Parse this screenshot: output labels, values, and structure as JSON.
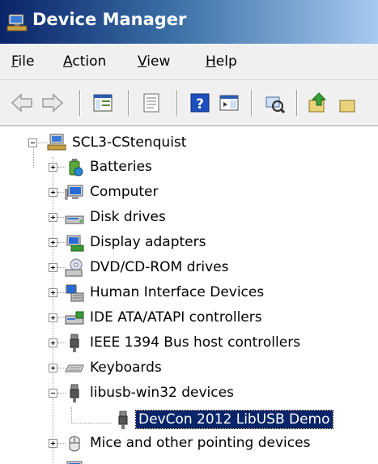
{
  "window": {
    "title": "Device Manager"
  },
  "menu": {
    "file": {
      "key": "F",
      "rest": "ile"
    },
    "action": {
      "key": "A",
      "rest": "ction"
    },
    "view": {
      "key": "V",
      "rest": "iew"
    },
    "help": {
      "key": "H",
      "rest": "elp"
    }
  },
  "tree": {
    "root": "SCL3-CStenquist",
    "items": [
      {
        "label": "Batteries",
        "icon": "battery-icon"
      },
      {
        "label": "Computer",
        "icon": "computer-icon"
      },
      {
        "label": "Disk drives",
        "icon": "disk-drive-icon"
      },
      {
        "label": "Display adapters",
        "icon": "display-adapter-icon"
      },
      {
        "label": "DVD/CD-ROM drives",
        "icon": "dvd-drive-icon"
      },
      {
        "label": "Human Interface Devices",
        "icon": "hid-icon"
      },
      {
        "label": "IDE ATA/ATAPI controllers",
        "icon": "ide-controller-icon"
      },
      {
        "label": "IEEE 1394 Bus host controllers",
        "icon": "ieee1394-icon"
      },
      {
        "label": "Keyboards",
        "icon": "keyboard-icon"
      },
      {
        "label": "libusb-win32 devices",
        "icon": "usb-icon"
      },
      {
        "label": "DevCon 2012 LibUSB Demo",
        "icon": "usb-device-icon"
      },
      {
        "label": "Mice and other pointing devices",
        "icon": "mouse-icon"
      }
    ]
  },
  "colors": {
    "selection": "#0a246a",
    "titlebar_start": "#0a246a",
    "titlebar_end": "#a6caf0"
  }
}
